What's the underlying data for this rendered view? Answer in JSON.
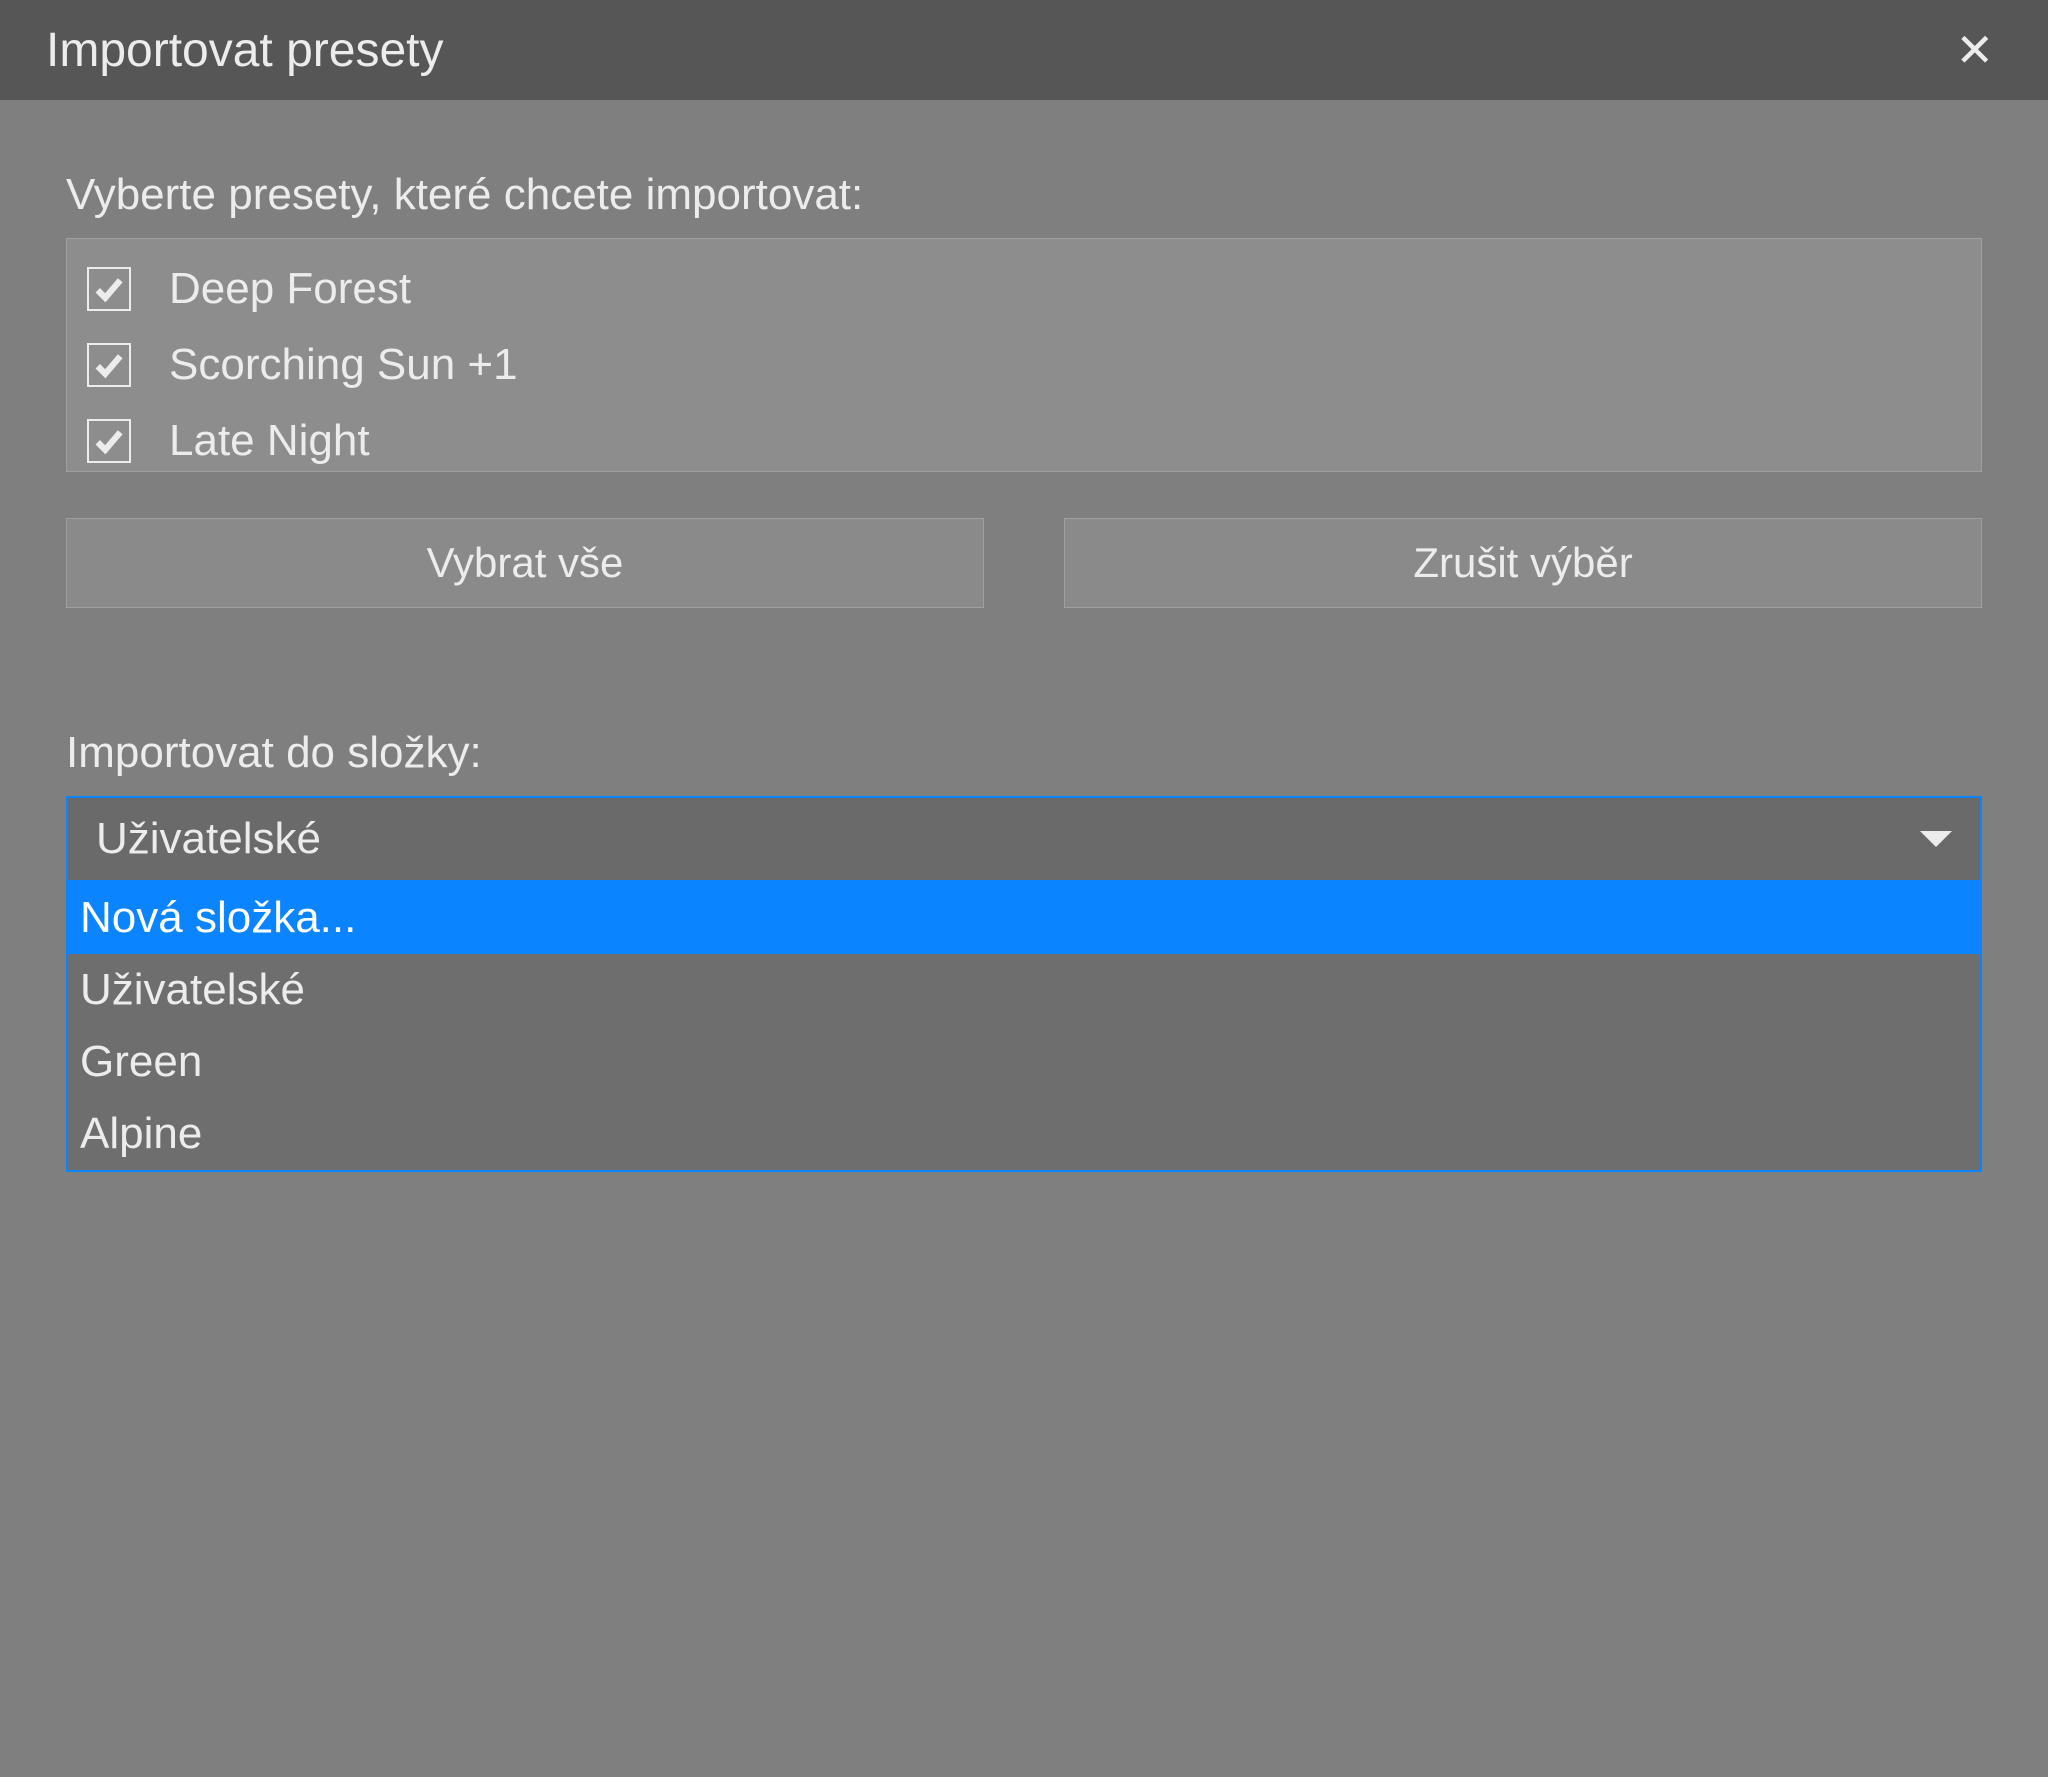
{
  "dialog": {
    "title": "Importovat presety"
  },
  "presetSection": {
    "label": "Vyberte presety, které chcete importovat:",
    "items": [
      {
        "label": "Deep Forest",
        "checked": true
      },
      {
        "label": "Scorching Sun +1",
        "checked": true
      },
      {
        "label": "Late Night",
        "checked": true
      }
    ]
  },
  "buttons": {
    "selectAll": "Vybrat vše",
    "deselect": "Zrušit výběr"
  },
  "folderSection": {
    "label": "Importovat do složky:",
    "selected": "Uživatelské",
    "options": [
      {
        "label": "Nová složka...",
        "highlighted": true
      },
      {
        "label": "Uživatelské",
        "highlighted": false
      },
      {
        "label": "Green",
        "highlighted": false
      },
      {
        "label": "Alpine",
        "highlighted": false
      }
    ]
  }
}
